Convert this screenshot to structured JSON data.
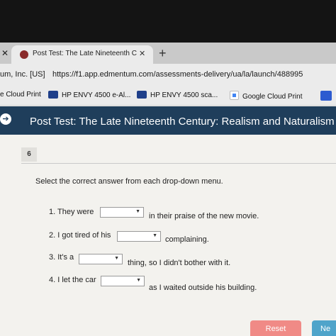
{
  "browser": {
    "tab_prev_close": "✕",
    "tab_title": "Post Test: The Late Nineteenth C",
    "tab_close": "✕",
    "new_tab": "+",
    "site_identity": "um, Inc. [US]",
    "url": "https://f1.app.edmentum.com/assessments-delivery/ua/la/launch/488995"
  },
  "bookmarks": [
    {
      "label": "e Cloud Print"
    },
    {
      "label": "HP ENVY 4500 e-Al..."
    },
    {
      "label": "HP ENVY 4500 sca..."
    },
    {
      "label": "Google Cloud Print"
    }
  ],
  "header": {
    "title": "Post Test: The Late Nineteenth Century: Realism and Naturalism"
  },
  "question": {
    "number": "6",
    "instruction": "Select the correct answer from each drop-down menu.",
    "items": [
      {
        "before": "1. They were",
        "after": "in their praise of the new movie.",
        "selected": ""
      },
      {
        "before": "2. I got tired of his",
        "after": "complaining.",
        "selected": ""
      },
      {
        "before": "3. It's a",
        "after": "thing, so I didn't bother with it.",
        "selected": ""
      },
      {
        "before": "4. I let the car",
        "after": "as I waited outside his building.",
        "selected": ""
      }
    ]
  },
  "footer": {
    "reset_label": "Reset",
    "next_label": "Ne"
  },
  "colors": {
    "header_bg": "#1f3e5b",
    "reset_bg": "#f08a86",
    "next_bg": "#4fa4ca"
  }
}
